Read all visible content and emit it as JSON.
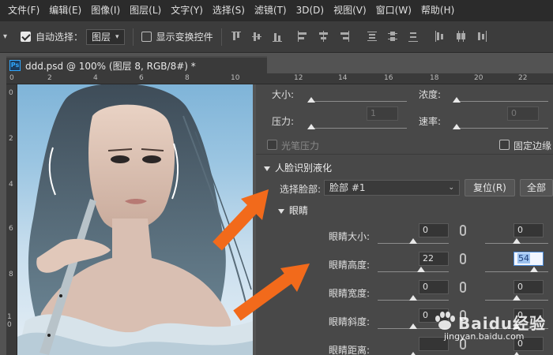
{
  "menu": [
    "文件(F)",
    "编辑(E)",
    "图像(I)",
    "图层(L)",
    "文字(Y)",
    "选择(S)",
    "滤镜(T)",
    "3D(D)",
    "视图(V)",
    "窗口(W)",
    "帮助(H)"
  ],
  "options": {
    "auto_select_label": "自动选择：",
    "auto_select_checked": true,
    "layer_select_value": "图层",
    "show_transform_label": "显示变换控件",
    "show_transform_checked": false
  },
  "document": {
    "tab_title": "ddd.psd @ 100% (图层 8, RGB/8#) *",
    "ps_badge": "Ps",
    "ruler_top": [
      "0",
      "2",
      "4",
      "6",
      "8",
      "10",
      "12",
      "14",
      "16",
      "18",
      "20",
      "22"
    ],
    "ruler_left": [
      "0",
      "2",
      "4",
      "6",
      "8",
      "1 0"
    ]
  },
  "liquify": {
    "size_label": "大小:",
    "density_label": "浓度:",
    "pressure_label": "压力:",
    "pressure_value": "1",
    "rate_label": "速率:",
    "rate_value": "0",
    "pen_pressure_label": "光笔压力",
    "fixed_edges_label": "固定边缘",
    "face_section_title": "人脸识别液化",
    "select_face_label": "选择脸部:",
    "select_face_value": "脸部 #1",
    "reset_button": "复位(R)",
    "all_button": "全部",
    "eyes_section_title": "眼睛",
    "eye_rows": [
      {
        "label": "眼睛大小:",
        "left": "0",
        "right": "0",
        "left_level": 0.5,
        "right_level": 0.5
      },
      {
        "label": "眼睛高度:",
        "left": "22",
        "right": "54",
        "left_level": 0.61,
        "right_level": 0.77
      },
      {
        "label": "眼睛宽度:",
        "left": "0",
        "right": "0",
        "left_level": 0.5,
        "right_level": 0.5
      },
      {
        "label": "眼睛斜度:",
        "left": "0",
        "right": "0",
        "left_level": 0.5,
        "right_level": 0.5
      },
      {
        "label": "眼睛距离:",
        "left": "",
        "right": "0",
        "left_level": 0.5,
        "right_level": 0.5
      }
    ]
  },
  "watermark": {
    "main": "Baidu经验",
    "sub": "jingyan.baidu.com"
  },
  "colors": {
    "accent_arrow": "#f26a1b",
    "menu_bg": "#2b2b2b",
    "panel_bg": "#484848"
  }
}
